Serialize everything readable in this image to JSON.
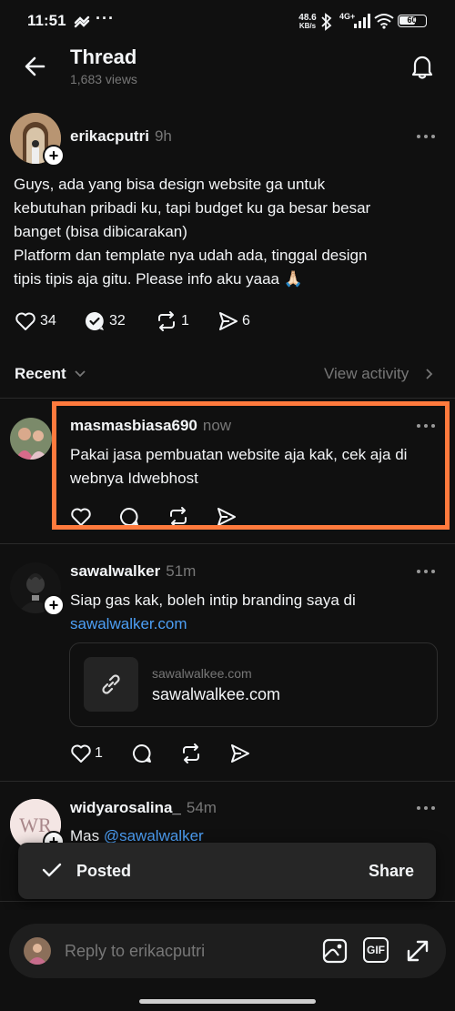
{
  "status_bar": {
    "time": "11:51",
    "network_speed": "48.6",
    "network_unit": "KB/s",
    "signal": "4G+",
    "battery": "60"
  },
  "header": {
    "title": "Thread",
    "views": "1,683 views"
  },
  "main_post": {
    "username": "erikacputri",
    "time": "9h",
    "text_lines": [
      "Guys, ada yang bisa design website ga untuk",
      "kebutuhan pribadi ku, tapi budget ku ga besar besar",
      "banget (bisa dibicarakan)",
      "Platform dan template nya udah ada, tinggal design",
      "tipis tipis aja gitu. Please info aku yaaa 🙏🏻"
    ],
    "likes": "34",
    "replies": "32",
    "reposts": "1",
    "shares": "6"
  },
  "sort_bar": {
    "label": "Recent",
    "view_activity": "View activity"
  },
  "replies": [
    {
      "username": "masmasbiasa690",
      "time": "now",
      "text_lines": [
        "Pakai jasa pembuatan website aja kak, cek aja di",
        "webnya Idwebhost"
      ],
      "highlight_color": "#ff7a3d"
    },
    {
      "username": "sawalwalker",
      "time": "51m",
      "text_line1": "Siap gas kak, boleh intip branding saya di",
      "link_text": "sawalwalker.com",
      "link_card": {
        "domain": "sawalwalkee.com",
        "title": "sawalwalkee.com"
      },
      "likes": "1"
    },
    {
      "username": "widyarosalina_",
      "time": "54m",
      "text_prefix": "Mas ",
      "mention": "@sawalwalker"
    }
  ],
  "toast": {
    "label": "Posted",
    "action": "Share"
  },
  "reply_bar": {
    "placeholder": "Reply to erikacputri",
    "gif_label": "GIF"
  },
  "colors": {
    "background": "#101010",
    "link": "#4d9ff5",
    "highlight": "#ff7a3d"
  }
}
